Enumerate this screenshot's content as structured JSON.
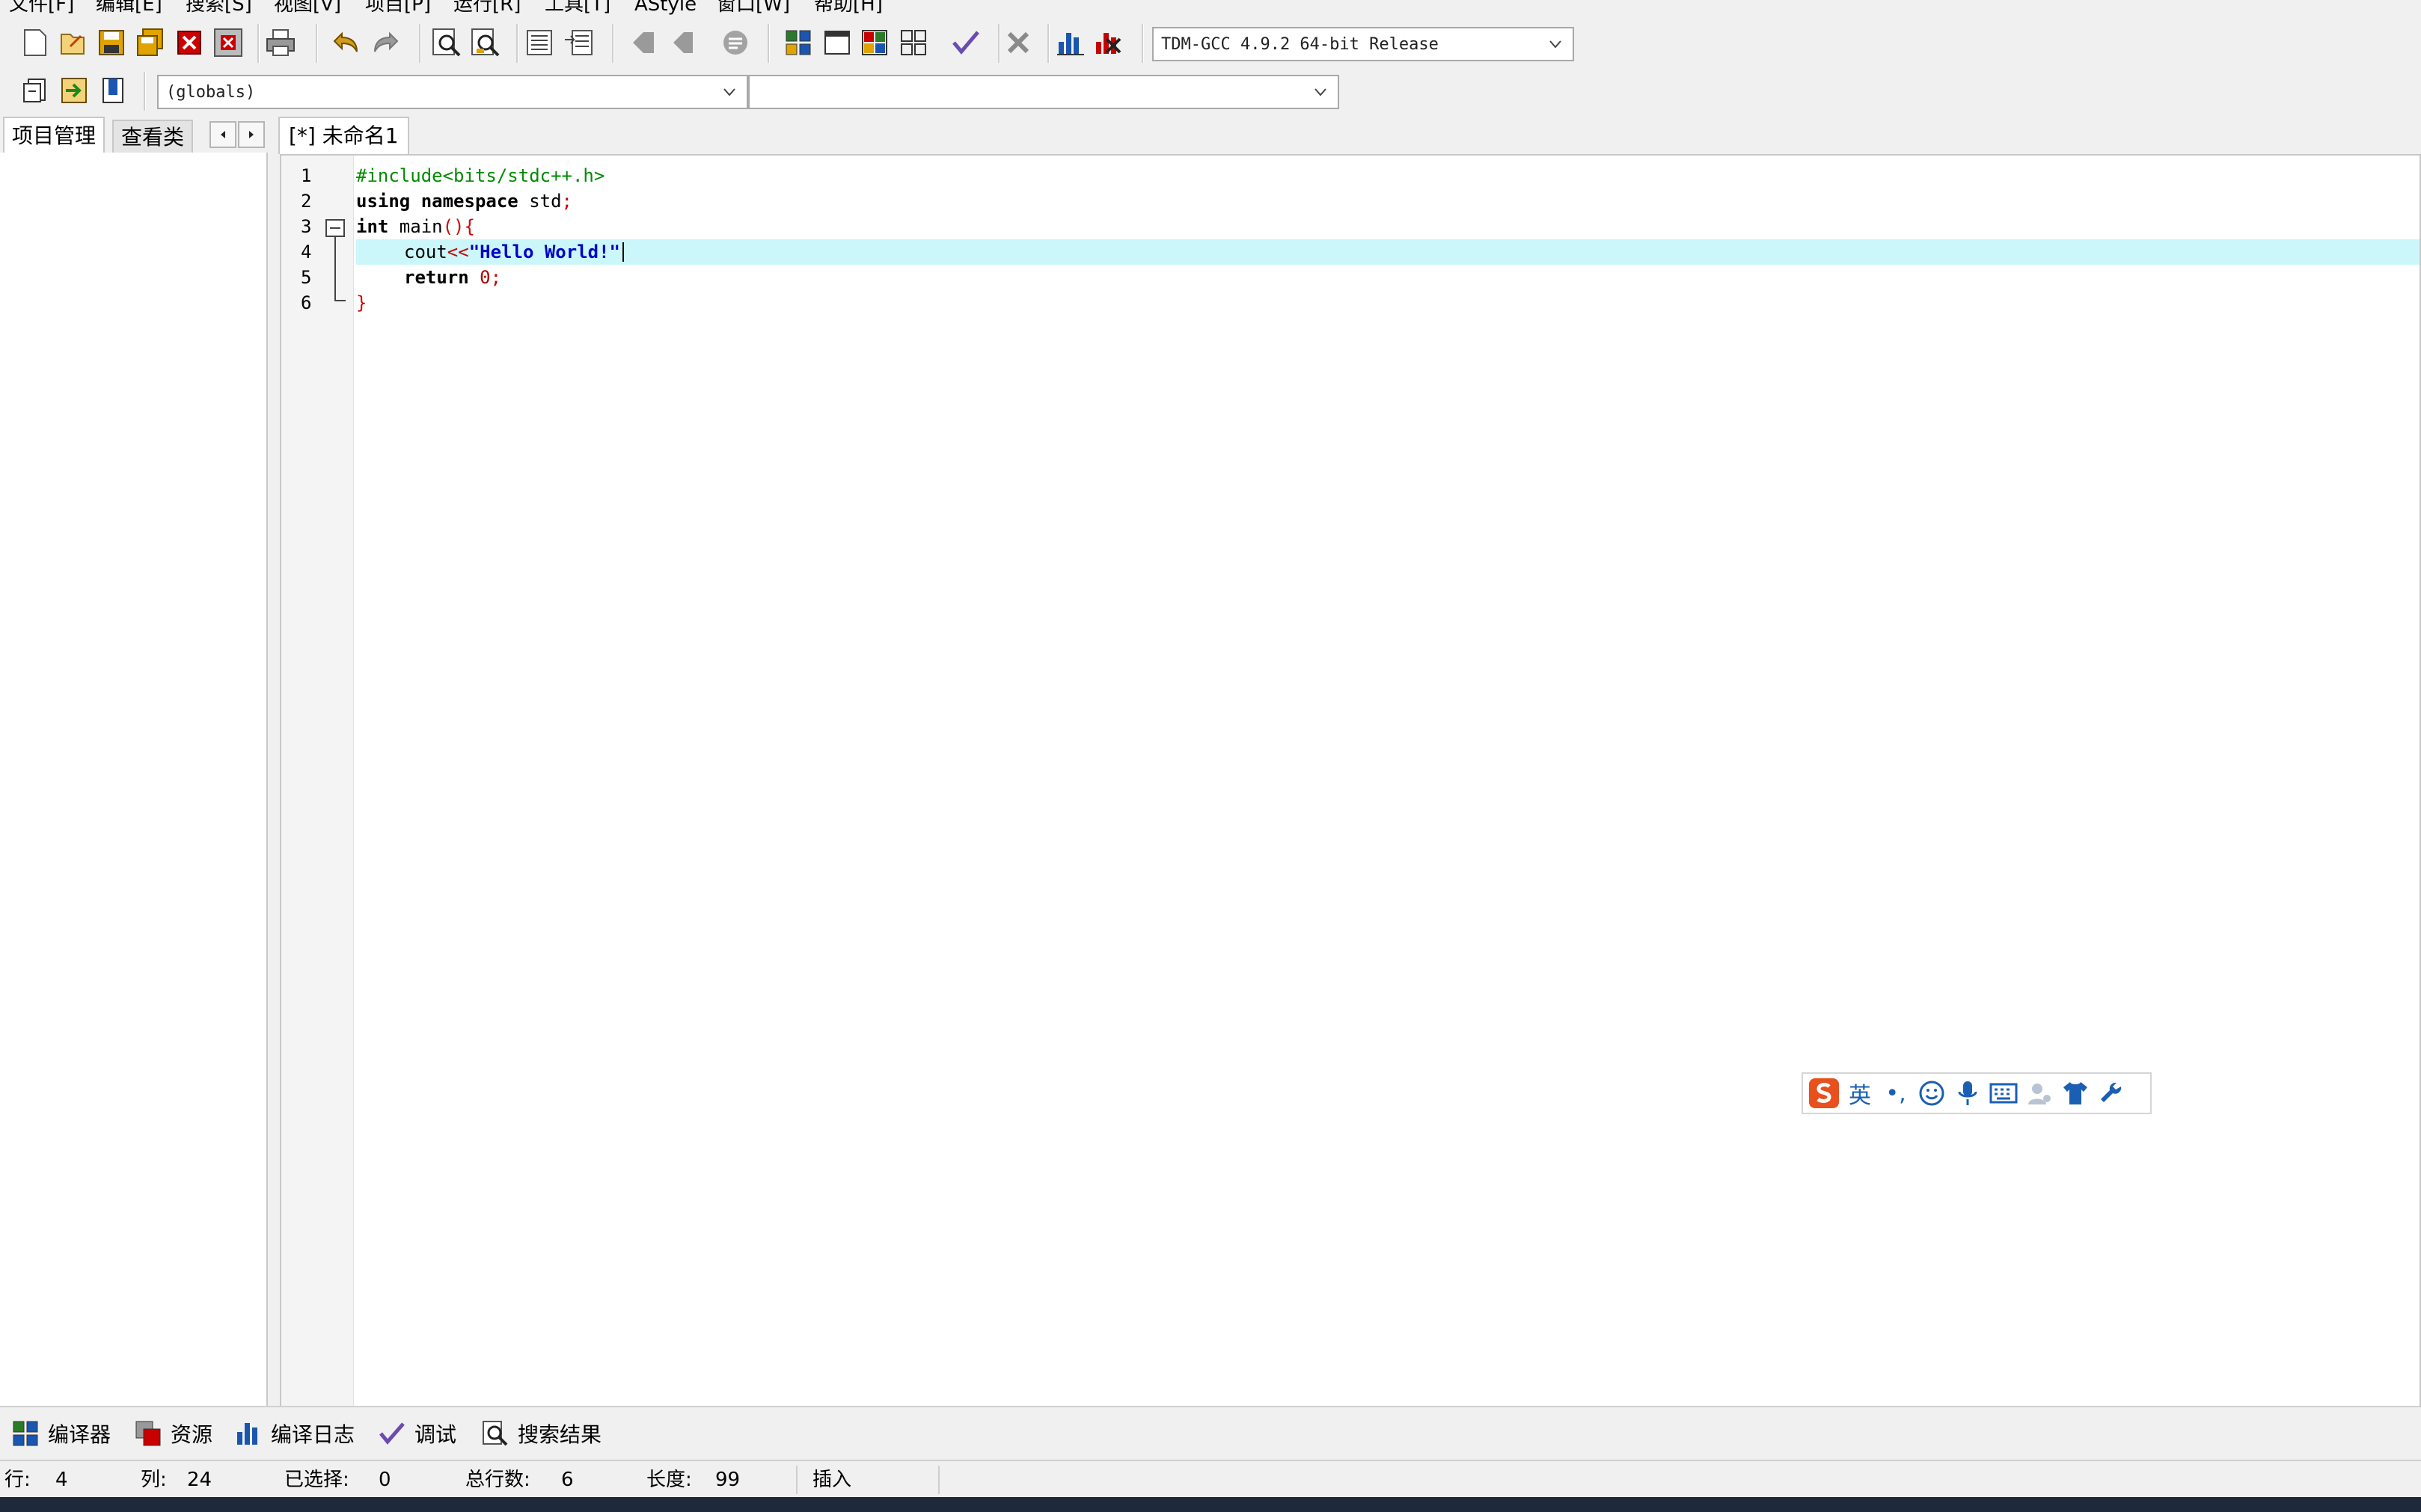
{
  "menu": {
    "items": [
      "文件[F]",
      "编辑[E]",
      "搜索[S]",
      "视图[V]",
      "项目[P]",
      "运行[R]",
      "工具[T]",
      "AStyle",
      "窗口[W]",
      "帮助[H]"
    ]
  },
  "toolbar": {
    "compiler_select": "TDM-GCC 4.9.2 64-bit Release",
    "scope_select": "(globals)",
    "member_select": ""
  },
  "left_panel": {
    "tabs": [
      "项目管理",
      "查看类"
    ]
  },
  "editor": {
    "tab_label": "[*] 未命名1",
    "lines": [
      {
        "no": "1"
      },
      {
        "no": "2"
      },
      {
        "no": "3"
      },
      {
        "no": "4"
      },
      {
        "no": "5"
      },
      {
        "no": "6"
      }
    ],
    "code": {
      "l1": "#include<bits/stdc++.h>",
      "l2_kw1": "using",
      "l2_kw2": "namespace",
      "l2_rest": " std",
      "l2_semi": ";",
      "l3_kw": "int",
      "l3_rest": " main",
      "l3_paren": "(){",
      "l4_ident": "cout",
      "l4_op": "<<",
      "l4_str": "\"Hello World!\"",
      "l5_kw": "return",
      "l5_num": "0",
      "l5_semi": ";",
      "l6": "}"
    },
    "highlight_color": "#ccf7fa"
  },
  "ime": {
    "lang": "英",
    "punct": "•,",
    "brand_color": "#e8501e"
  },
  "bottom_tabs": [
    "编译器",
    "资源",
    "编译日志",
    "调试",
    "搜索结果"
  ],
  "status": {
    "row_label": "行:",
    "row_value": "4",
    "col_label": "列:",
    "col_value": "24",
    "sel_label": "已选择:",
    "sel_value": "0",
    "total_label": "总行数:",
    "total_value": "6",
    "len_label": "长度:",
    "len_value": "99",
    "mode": "插入"
  }
}
